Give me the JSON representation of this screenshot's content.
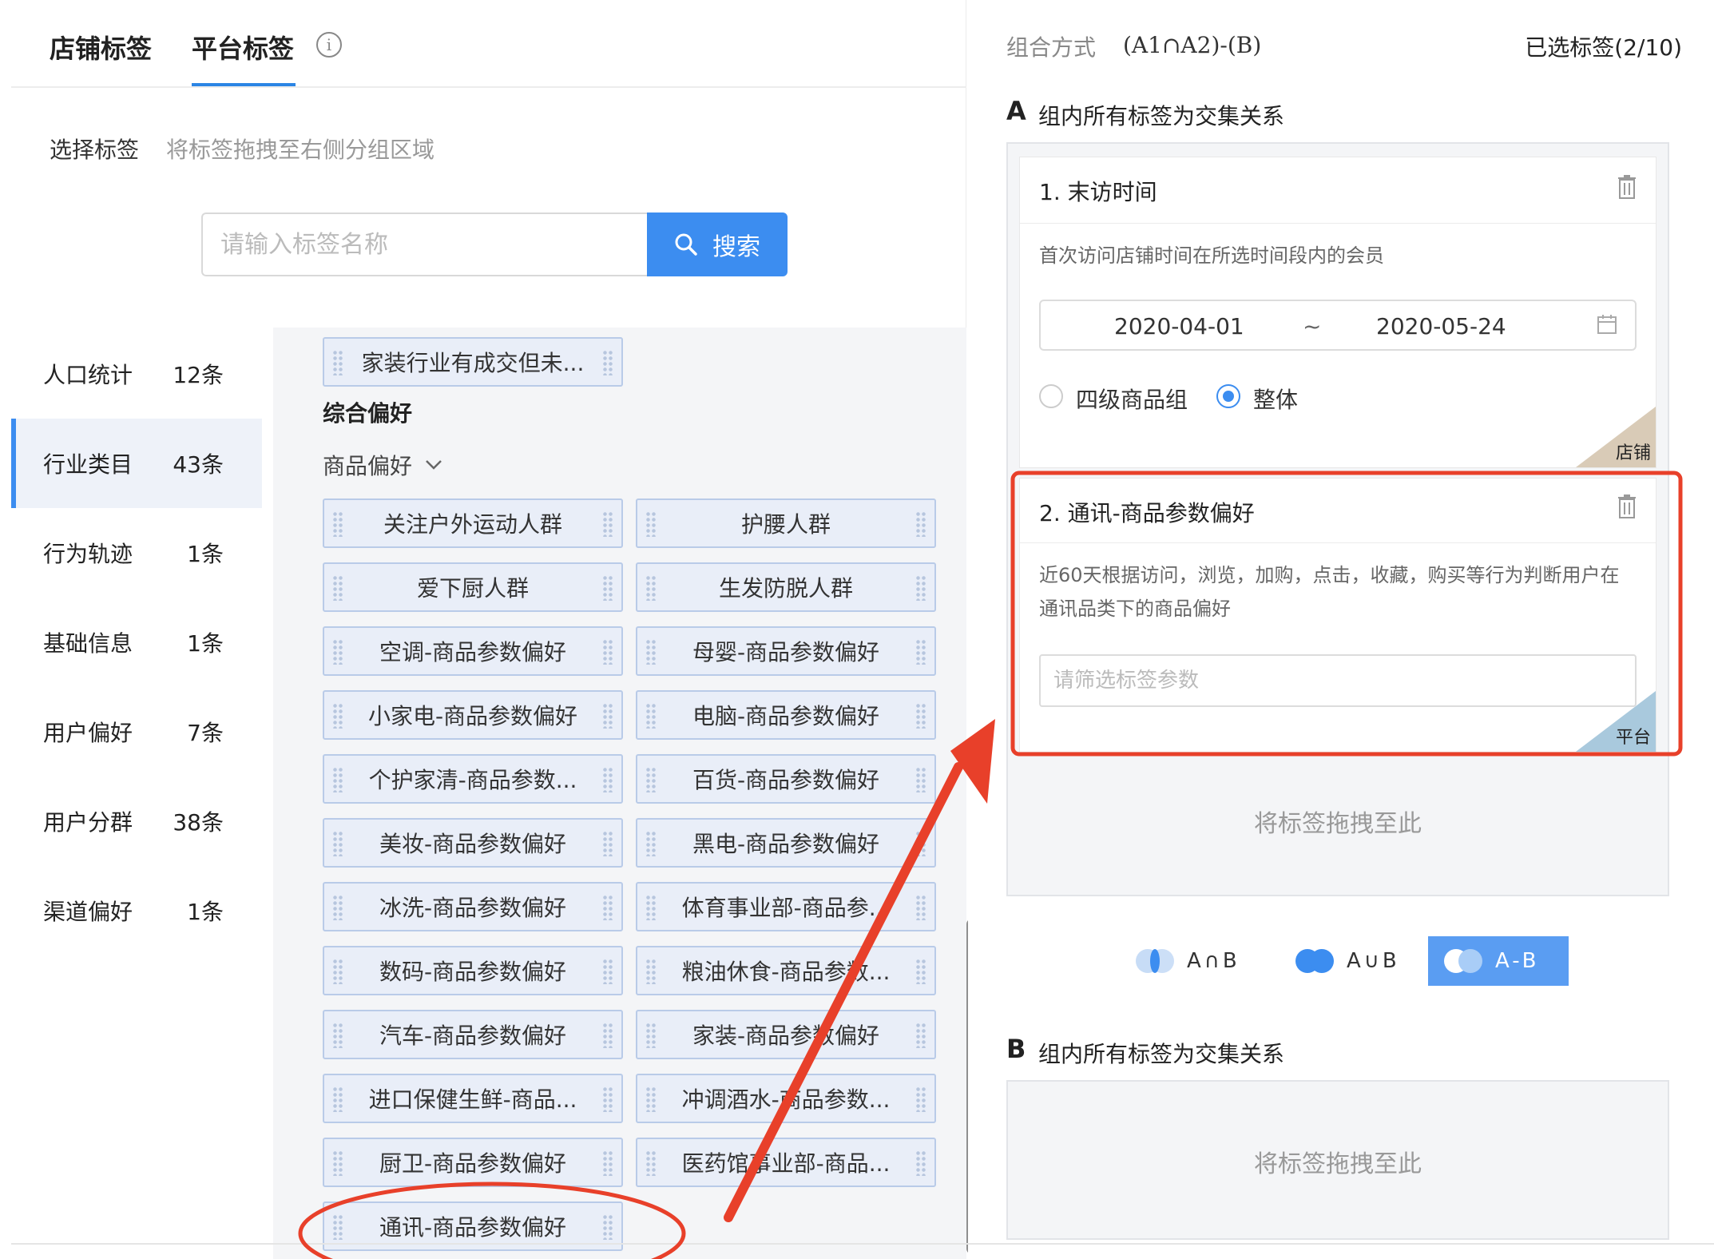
{
  "header": {
    "tabs": [
      {
        "label": "店铺标签",
        "active": false
      },
      {
        "label": "平台标签",
        "active": true
      }
    ],
    "info_icon": "info-circle-icon"
  },
  "select": {
    "title": "选择标签",
    "hint": "将标签拖拽至右侧分组区域"
  },
  "search": {
    "placeholder": "请输入标签名称",
    "button_label": "搜索",
    "icon": "search-icon"
  },
  "sidebar": {
    "items": [
      {
        "name": "人口统计",
        "count": "12条",
        "active": false
      },
      {
        "name": "行业类目",
        "count": "43条",
        "active": true
      },
      {
        "name": "行为轨迹",
        "count": "1条",
        "active": false
      },
      {
        "name": "基础信息",
        "count": "1条",
        "active": false
      },
      {
        "name": "用户偏好",
        "count": "7条",
        "active": false
      },
      {
        "name": "用户分群",
        "count": "38条",
        "active": false
      },
      {
        "name": "渠道偏好",
        "count": "1条",
        "active": false
      }
    ]
  },
  "tags": {
    "top_chip": "家装行业有成交但未...",
    "section_title": "综合偏好",
    "subsection": "商品偏好",
    "chips": [
      "关注户外运动人群",
      "护腰人群",
      "爱下厨人群",
      "生发防脱人群",
      "空调-商品参数偏好",
      "母婴-商品参数偏好",
      "小家电-商品参数偏好",
      "电脑-商品参数偏好",
      "个护家清-商品参数...",
      "百货-商品参数偏好",
      "美妆-商品参数偏好",
      "黑电-商品参数偏好",
      "冰洗-商品参数偏好",
      "体育事业部-商品参...",
      "数码-商品参数偏好",
      "粮油休食-商品参数...",
      "汽车-商品参数偏好",
      "家装-商品参数偏好",
      "进口保健生鲜-商品...",
      "冲调酒水-商品参数...",
      "厨卫-商品参数偏好",
      "医药馆事业部-商品...",
      "通讯-商品参数偏好"
    ]
  },
  "right": {
    "combo_label": "组合方式",
    "combo_value": "(A1∩A2)-(B)",
    "selected": "已选标签(2/10)",
    "group_a": {
      "letter": "A",
      "desc": "组内所有标签为交集关系",
      "cards": [
        {
          "title": "1. 末访时间",
          "desc": "首次访问店铺时间在所选时间段内的会员",
          "date_start": "2020-04-01",
          "date_sep": "~",
          "date_end": "2020-05-24",
          "radio_1": "四级商品组",
          "radio_2": "整体",
          "corner": "店铺",
          "corner_color": "#d9cbb7"
        },
        {
          "title": "2. 通讯-商品参数偏好",
          "desc_line1": "近60天根据访问，浏览，加购，点击，收藏，购买等行为判断用户在",
          "desc_line2": "通讯品类下的商品偏好",
          "placeholder": "请筛选标签参数",
          "corner": "平台",
          "corner_color": "#a9c9dd"
        }
      ],
      "drop_hint": "将标签拖拽至此"
    },
    "operators": [
      {
        "label": "A∩B",
        "active": false
      },
      {
        "label": "A∪B",
        "active": false
      },
      {
        "label": "A-B",
        "active": true
      }
    ],
    "group_b": {
      "letter": "B",
      "desc": "组内所有标签为交集关系",
      "drop_hint": "将标签拖拽至此"
    }
  },
  "colors": {
    "accent": "#3c8df0",
    "annotation": "#e8402a"
  }
}
